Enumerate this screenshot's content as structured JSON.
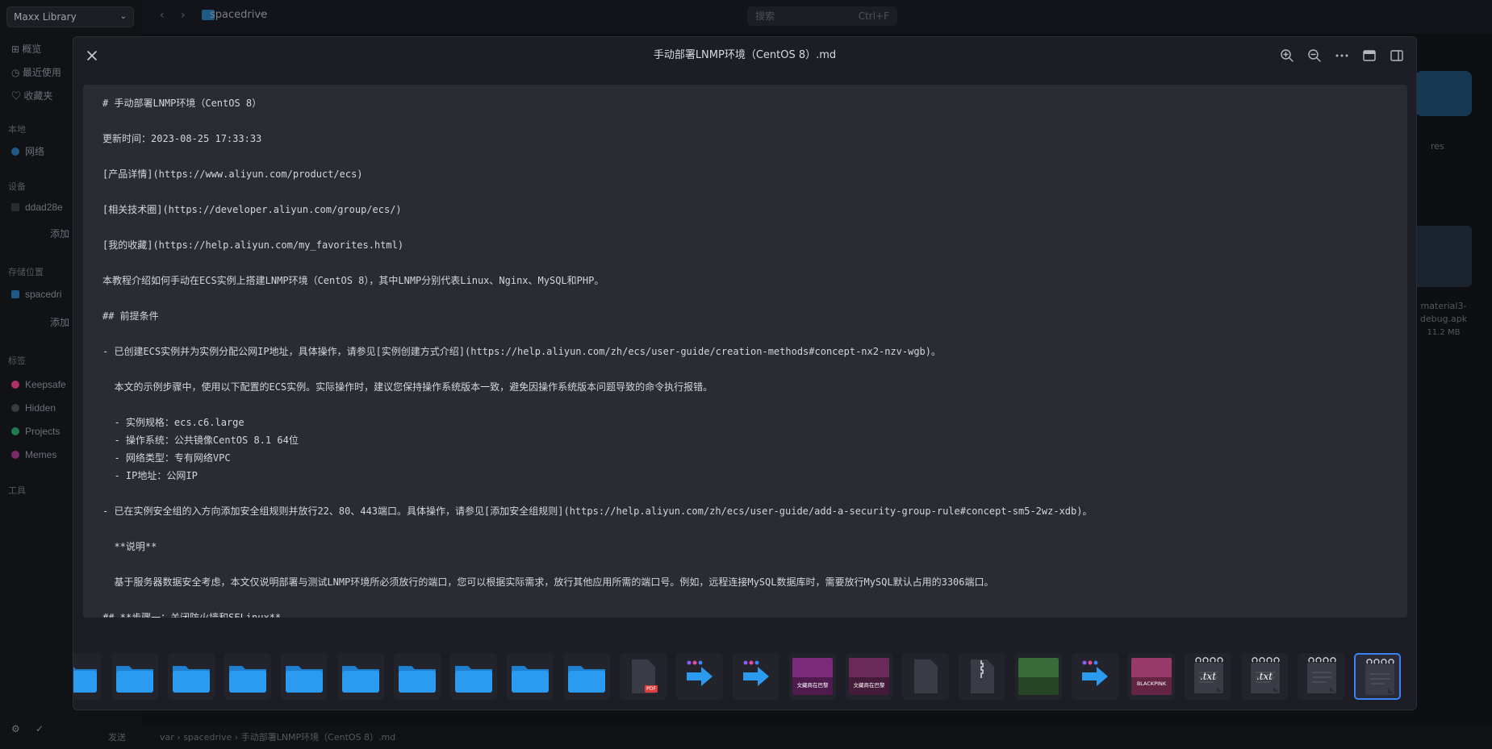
{
  "background": {
    "library_switcher": "Maxx Library",
    "sidebar": {
      "items_top": [
        "概览",
        "最近使用",
        "收藏夹"
      ],
      "section_local": "本地",
      "network": "网络",
      "section_devices": "设备",
      "device": "ddad28e",
      "device_add": "添加",
      "section_locations": "存储位置",
      "location": "spacedri",
      "location_add": "添加",
      "section_tags": "标签",
      "tags": [
        {
          "label": "Keepsafe",
          "color": "#b0306a"
        },
        {
          "label": "Hidden",
          "color": "#3a3b42"
        },
        {
          "label": "Projects",
          "color": "#1f7a4d"
        },
        {
          "label": "Memes",
          "color": "#7a2a6a"
        }
      ],
      "section_tools": "工具"
    },
    "topbar": {
      "crumb": "spacedrive",
      "search_placeholder": "搜索",
      "search_shortcut": "Ctrl+F"
    },
    "right_panel": {
      "label_res": "res",
      "file_name": "material3-debug.apk",
      "file_size": "11.2 MB"
    },
    "status_bar": {
      "path": [
        "var",
        "spacedrive",
        "手动部署LNMP环境（CentOS 8）.md"
      ],
      "sync_label": "发送"
    }
  },
  "modal": {
    "title": "手动部署LNMP环境（CentOS 8）.md",
    "icons": [
      "close-icon",
      "zoom-in-icon",
      "zoom-out-icon",
      "more-icon",
      "panel-icon",
      "sidebar-icon"
    ],
    "lines": [
      "# 手动部署LNMP环境（CentOS 8）",
      "",
      "更新时间：2023-08-25 17:33:33",
      "",
      "[产品详情](https://www.aliyun.com/product/ecs)",
      "",
      "[相关技术圈](https://developer.aliyun.com/group/ecs/)",
      "",
      "[我的收藏](https://help.aliyun.com/my_favorites.html)",
      "",
      "本教程介绍如何手动在ECS实例上搭建LNMP环境（CentOS 8），其中LNMP分别代表Linux、Nginx、MySQL和PHP。",
      "",
      "## 前提条件",
      "",
      "- 已创建ECS实例并为实例分配公网IP地址，具体操作，请参见[实例创建方式介绍](https://help.aliyun.com/zh/ecs/user-guide/creation-methods#concept-nx2-nzv-wgb)。",
      "",
      "  本文的示例步骤中，使用以下配置的ECS实例。实际操作时，建议您保持操作系统版本一致，避免因操作系统版本问题导致的命令执行报错。",
      "",
      "  - 实例规格：ecs.c6.large",
      "  - 操作系统：公共镜像CentOS 8.1 64位",
      "  - 网络类型：专有网络VPC",
      "  - IP地址：公网IP",
      "",
      "- 已在实例安全组的入方向添加安全组规则并放行22、80、443端口。具体操作，请参见[添加安全组规则](https://help.aliyun.com/zh/ecs/user-guide/add-a-security-group-rule#concept-sm5-2wz-xdb)。",
      "",
      "  **说明**",
      "",
      "  基于服务器数据安全考虑，本文仅说明部署与测试LNMP环境所必须放行的端口，您可以根据实际需求，放行其他应用所需的端口号。例如，远程连接MySQL数据库时，需要放行MySQL默认占用的3306端口。",
      "",
      "## **步骤一：关闭防火墙和SELinux**"
    ],
    "thumbnails": [
      {
        "kind": "folder"
      },
      {
        "kind": "folder"
      },
      {
        "kind": "folder"
      },
      {
        "kind": "folder"
      },
      {
        "kind": "folder"
      },
      {
        "kind": "folder"
      },
      {
        "kind": "folder"
      },
      {
        "kind": "folder"
      },
      {
        "kind": "folder"
      },
      {
        "kind": "folder"
      },
      {
        "kind": "pdf",
        "badge": "PDF"
      },
      {
        "kind": "arrow"
      },
      {
        "kind": "arrow"
      },
      {
        "kind": "image",
        "tint": "#7a2a7a",
        "caption": "文藏商在巴黎"
      },
      {
        "kind": "image",
        "tint": "#6a2a5a",
        "caption": "文藏商在巴黎"
      },
      {
        "kind": "blank"
      },
      {
        "kind": "zip"
      },
      {
        "kind": "image",
        "tint": "#3a6a3a",
        "caption": ""
      },
      {
        "kind": "arrow"
      },
      {
        "kind": "image",
        "tint": "#9a3a6a",
        "caption": "BLACKPINK"
      },
      {
        "kind": "txt",
        "badge": ".txt"
      },
      {
        "kind": "txt",
        "badge": ".txt"
      },
      {
        "kind": "note"
      },
      {
        "kind": "note",
        "selected": true
      }
    ]
  }
}
